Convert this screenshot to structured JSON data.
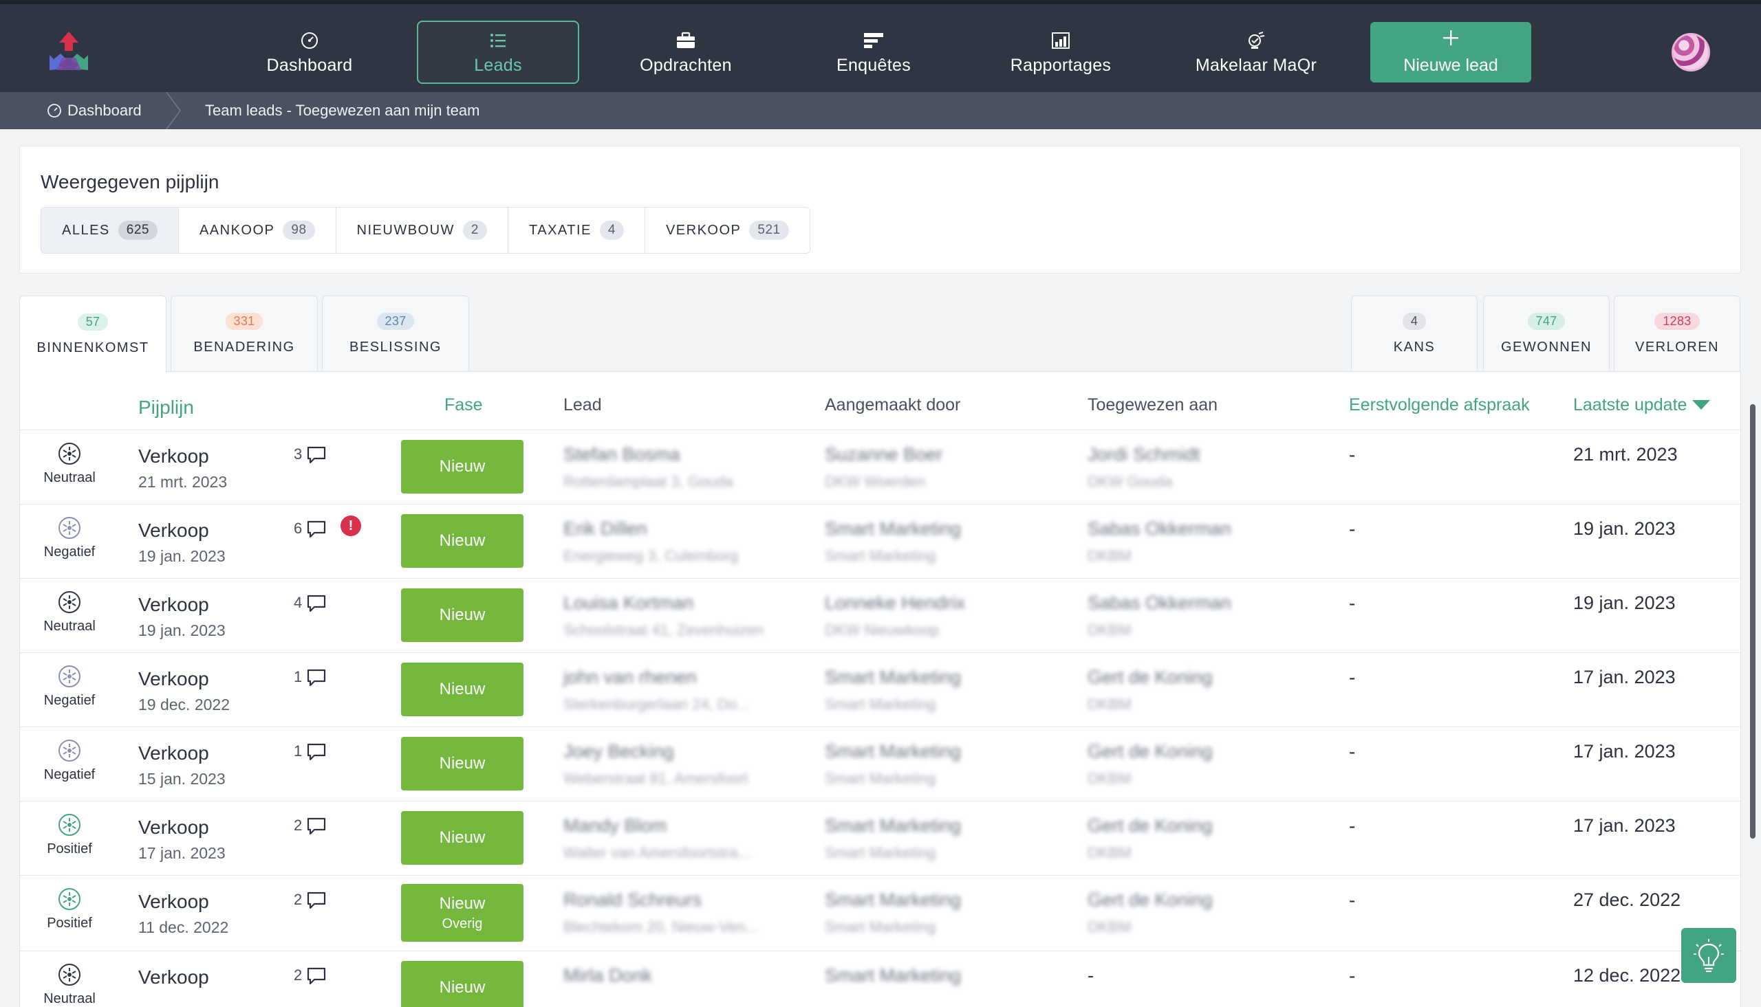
{
  "nav": {
    "items": [
      {
        "label": "Dashboard",
        "icon": "dashboard-icon"
      },
      {
        "label": "Leads",
        "icon": "list-icon",
        "active": true
      },
      {
        "label": "Opdrachten",
        "icon": "briefcase-icon"
      },
      {
        "label": "Enquêtes",
        "icon": "survey-icon"
      },
      {
        "label": "Rapportages",
        "icon": "chart-icon"
      },
      {
        "label": "Makelaar MaQr",
        "icon": "maqr-icon"
      }
    ],
    "new_lead_label": "Nieuwe lead"
  },
  "breadcrumb": {
    "home": "Dashboard",
    "current": "Team leads - Toegewezen aan mijn team"
  },
  "pipeline": {
    "title": "Weergegeven pijplijn",
    "tabs": [
      {
        "label": "ALLES",
        "count": "625",
        "active": true
      },
      {
        "label": "AANKOOP",
        "count": "98"
      },
      {
        "label": "NIEUWBOUW",
        "count": "2"
      },
      {
        "label": "TAXATIE",
        "count": "4"
      },
      {
        "label": "VERKOOP",
        "count": "521"
      }
    ]
  },
  "stages": {
    "left": [
      {
        "label": "BINNENKOMST",
        "count": "57",
        "color": "#5fbf9f",
        "bg": "#dcf1ea"
      },
      {
        "label": "BENADERING",
        "count": "331",
        "color": "#e07a52",
        "bg": "#fbe0d3"
      },
      {
        "label": "BESLISSING",
        "count": "237",
        "color": "#5b86b0",
        "bg": "#dce6f0"
      }
    ],
    "right": [
      {
        "label": "KANS",
        "count": "4",
        "color": "#4a5060",
        "bg": "#e1e3e7"
      },
      {
        "label": "GEWONNEN",
        "count": "747",
        "color": "#43a483",
        "bg": "#d6eee5"
      },
      {
        "label": "VERLOREN",
        "count": "1283",
        "color": "#c8405d",
        "bg": "#f7d8df"
      }
    ]
  },
  "table": {
    "headers": {
      "pijplijn": "Pijplijn",
      "fase": "Fase",
      "lead": "Lead",
      "aangemaakt": "Aangemaakt door",
      "toegewezen": "Toegewezen aan",
      "afspraak": "Eerstvolgende afspraak",
      "update": "Laatste update"
    },
    "rows": [
      {
        "sentiment": "Neutraal",
        "pipe": "Verkoop",
        "date": "21 mrt. 2023",
        "comments": "3",
        "alert": false,
        "fase": "Nieuw",
        "fase_sub": "",
        "lead": "Stefan Bosma",
        "lead_addr": "Rotterdamplaat 3, Gouda",
        "created": "Suzanne Boer",
        "created_sub": "DKW Woerden",
        "assigned": "Jordi Schmidt",
        "assigned_sub": "DKW Gouda",
        "afspraak": "-",
        "update": "21 mrt. 2023"
      },
      {
        "sentiment": "Negatief",
        "pipe": "Verkoop",
        "date": "19 jan. 2023",
        "comments": "6",
        "alert": true,
        "fase": "Nieuw",
        "fase_sub": "",
        "lead": "Erik Dillen",
        "lead_addr": "Energieweg 3, Culemborg",
        "created": "Smart Marketing",
        "created_sub": "Smart Marketing",
        "assigned": "Sabas Okkerman",
        "assigned_sub": "DKBM",
        "afspraak": "-",
        "update": "19 jan. 2023"
      },
      {
        "sentiment": "Neutraal",
        "pipe": "Verkoop",
        "date": "19 jan. 2023",
        "comments": "4",
        "alert": false,
        "fase": "Nieuw",
        "fase_sub": "",
        "lead": "Louisa Kortman",
        "lead_addr": "Schoolstraat 41, Zevenhuizen",
        "created": "Lonneke Hendrix",
        "created_sub": "DKW Nieuwkoop",
        "assigned": "Sabas Okkerman",
        "assigned_sub": "DKBM",
        "afspraak": "-",
        "update": "19 jan. 2023"
      },
      {
        "sentiment": "Negatief",
        "pipe": "Verkoop",
        "date": "19 dec. 2022",
        "comments": "1",
        "alert": false,
        "fase": "Nieuw",
        "fase_sub": "",
        "lead": "john van rhenen",
        "lead_addr": "Sterkenburgerlaan 24, Do...",
        "created": "Smart Marketing",
        "created_sub": "Smart Marketing",
        "assigned": "Gert de Koning",
        "assigned_sub": "DKBM",
        "afspraak": "-",
        "update": "17 jan. 2023"
      },
      {
        "sentiment": "Negatief",
        "pipe": "Verkoop",
        "date": "15 jan. 2023",
        "comments": "1",
        "alert": false,
        "fase": "Nieuw",
        "fase_sub": "",
        "lead": "Joey Becking",
        "lead_addr": "Weberstraat 81, Amersfoort",
        "created": "Smart Marketing",
        "created_sub": "Smart Marketing",
        "assigned": "Gert de Koning",
        "assigned_sub": "DKBM",
        "afspraak": "-",
        "update": "17 jan. 2023"
      },
      {
        "sentiment": "Positief",
        "pipe": "Verkoop",
        "date": "17 jan. 2023",
        "comments": "2",
        "alert": false,
        "fase": "Nieuw",
        "fase_sub": "",
        "lead": "Mandy Blom",
        "lead_addr": "Walter van Amersfoortstra...",
        "created": "Smart Marketing",
        "created_sub": "Smart Marketing",
        "assigned": "Gert de Koning",
        "assigned_sub": "DKBM",
        "afspraak": "-",
        "update": "17 jan. 2023"
      },
      {
        "sentiment": "Positief",
        "pipe": "Verkoop",
        "date": "11 dec. 2022",
        "comments": "2",
        "alert": false,
        "fase": "Nieuw",
        "fase_sub": "Overig",
        "lead": "Ronald Schreurs",
        "lead_addr": "Blechtekom 20, Nieuw-Ven...",
        "created": "Smart Marketing",
        "created_sub": "Smart Marketing",
        "assigned": "Gert de Koning",
        "assigned_sub": "DKBM",
        "afspraak": "-",
        "update": "27 dec. 2022"
      },
      {
        "sentiment": "Neutraal",
        "pipe": "Verkoop",
        "date": "",
        "comments": "2",
        "alert": false,
        "fase": "Nieuw",
        "fase_sub": "",
        "lead": "Mirla Donk",
        "lead_addr": "",
        "created": "Smart Marketing",
        "created_sub": "",
        "assigned": "-",
        "assigned_sub": "",
        "afspraak": "-",
        "update": "12 dec. 2022"
      }
    ]
  },
  "colors": {
    "accent": "#43a483",
    "fase_green": "#73b83d",
    "alert": "#d9304c",
    "topbar": "#2f3542",
    "neutral_icon": "#2f3542",
    "negative_icon": "#8a8fb5",
    "positive_icon": "#43a483"
  }
}
